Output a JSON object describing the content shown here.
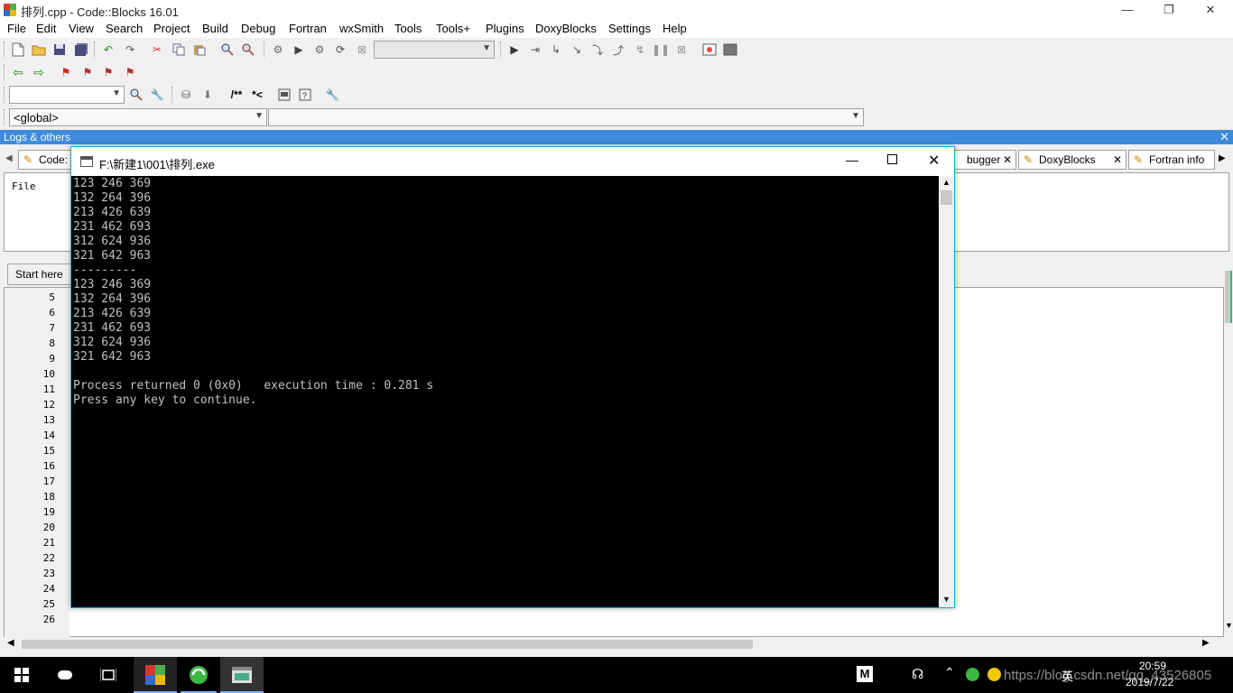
{
  "window": {
    "title": "排列.cpp - Code::Blocks 16.01",
    "minimize": "—",
    "maximize": "❐",
    "close": "✕"
  },
  "menu": [
    "File",
    "Edit",
    "View",
    "Search",
    "Project",
    "Build",
    "Debug",
    "Fortran",
    "wxSmith",
    "Tools",
    "Tools+",
    "Plugins",
    "DoxyBlocks",
    "Settings",
    "Help"
  ],
  "toolbar3": {
    "doxy_comment": "/**",
    "doxy_line": "*<"
  },
  "scope": {
    "global": "<global>",
    "symbol": ""
  },
  "logs": {
    "header": "Logs & others",
    "tabs": [
      "Code:",
      "bugger",
      "DoxyBlocks",
      "Fortran info"
    ],
    "content": "File"
  },
  "editor": {
    "tab": "Start here",
    "line_numbers": [
      "5",
      "6",
      "7",
      "8",
      "9",
      "10",
      "11",
      "12",
      "13",
      "14",
      "15",
      "16",
      "17",
      "18",
      "19",
      "20",
      "21",
      "22",
      "23",
      "24",
      "25",
      "26"
    ]
  },
  "console": {
    "title": "F:\\新建1\\001\\排列.exe",
    "lines": [
      "123 246 369",
      "132 264 396",
      "213 426 639",
      "231 462 693",
      "312 624 936",
      "321 642 963",
      "---------",
      "123 246 369",
      "132 264 396",
      "213 426 639",
      "231 462 693",
      "312 624 936",
      "321 642 963",
      "",
      "Process returned 0 (0x0)   execution time : 0.281 s",
      "Press any key to continue."
    ]
  },
  "taskbar": {
    "time": "20:59",
    "date": "2019/7/22",
    "ime": "英",
    "watermark": "https://blog.csdn.net/qq_43526805",
    "m_label": "M"
  },
  "colors": {
    "logs_header": "#3c8bdc",
    "console_bg": "#000000",
    "console_text": "#c0c0c0",
    "console_border": "#1ea5e0",
    "taskbar": "#000000"
  }
}
